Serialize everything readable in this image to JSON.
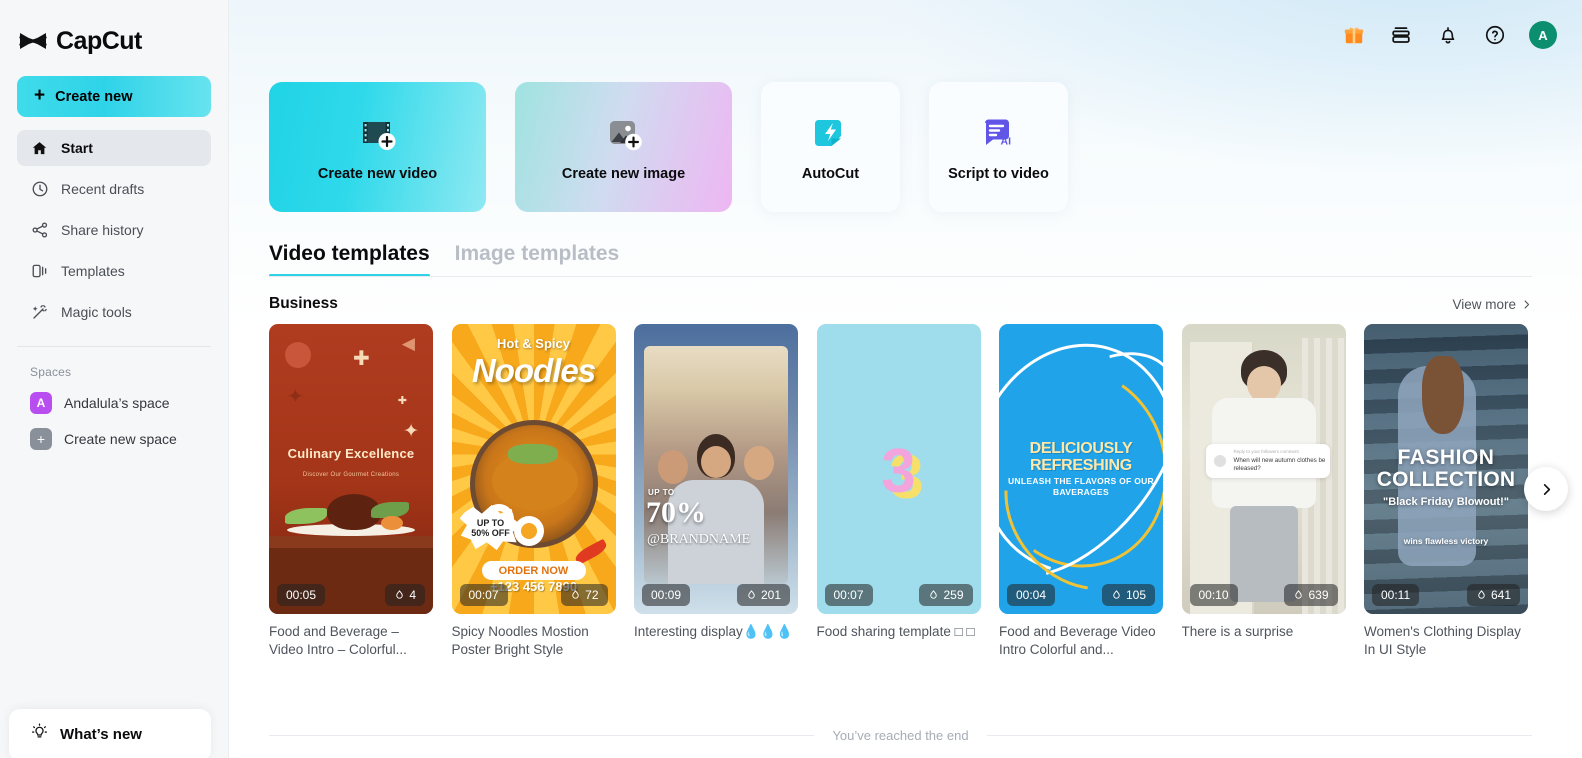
{
  "brand": {
    "name": "CapCut"
  },
  "sidebar": {
    "create_new_label": "Create new",
    "items": [
      {
        "label": "Start",
        "icon": "home-icon"
      },
      {
        "label": "Recent drafts",
        "icon": "clock-icon"
      },
      {
        "label": "Share history",
        "icon": "share-icon"
      },
      {
        "label": "Templates",
        "icon": "templates-icon"
      },
      {
        "label": "Magic tools",
        "icon": "magic-wand-icon"
      }
    ],
    "spaces_label": "Spaces",
    "spaces": [
      {
        "label": "Andalula’s space",
        "badge": "A",
        "badge_color": "#b84ef0"
      },
      {
        "label": "Create new space",
        "badge": "+",
        "badge_color": "#8a9099"
      }
    ],
    "whats_new_label": "What’s new"
  },
  "topbar": {
    "icons": [
      "gift-icon",
      "wallet-icon",
      "bell-icon",
      "help-icon"
    ],
    "avatar_initial": "A",
    "avatar_color": "#0b8f6e"
  },
  "actions": [
    {
      "label": "Create new video",
      "icon": "film-plus-icon"
    },
    {
      "label": "Create new image",
      "icon": "image-plus-icon"
    },
    {
      "label": "AutoCut",
      "icon": "autocut-icon"
    },
    {
      "label": "Script to video",
      "icon": "script-ai-icon"
    }
  ],
  "tabs": [
    {
      "label": "Video templates",
      "active": true
    },
    {
      "label": "Image templates",
      "active": false
    }
  ],
  "section": {
    "title": "Business",
    "view_more_label": "View more"
  },
  "templates": [
    {
      "caption": "Food and Beverage – Video Intro – Colorful...",
      "duration": "00:05",
      "likes": "4",
      "art": "t1",
      "art_text": {
        "title": "Culinary Excellence",
        "sub": "Discover Our Gourmet Creations"
      }
    },
    {
      "caption": "Spicy Noodles Mostion Poster Bright Style",
      "duration": "00:07",
      "likes": "72",
      "art": "t2",
      "art_text": {
        "hot": "Hot & Spicy",
        "noodles": "Noodles",
        "burst1": "UP TO",
        "burst2": "50% OFF",
        "order": "ORDER NOW",
        "phone": "+123 456 7890"
      }
    },
    {
      "caption": "Interesting display💧💧💧",
      "duration": "00:09",
      "likes": "201",
      "art": "t3",
      "art_text": {
        "upto": "UP TO",
        "pct": "70%",
        "brand": "@BRANDNAME"
      }
    },
    {
      "caption": "Food sharing template □ □",
      "duration": "00:07",
      "likes": "259",
      "art": "t4",
      "art_text": {
        "count": "3"
      }
    },
    {
      "caption": "Food and Beverage Video Intro Colorful and...",
      "duration": "00:04",
      "likes": "105",
      "art": "t5",
      "art_text": {
        "title": "DELICIOUSLY REFRESHING",
        "sub": "UNLEASH THE FLAVORS OF OUR BAVERAGES"
      }
    },
    {
      "caption": "There is a surprise",
      "duration": "00:10",
      "likes": "639",
      "art": "t6",
      "art_text": {
        "reply": "Reply to your followers comment",
        "msg": "When will new autumn clothes be released?"
      }
    },
    {
      "caption": "Women's Clothing Display In UI Style",
      "duration": "00:11",
      "likes": "641",
      "art": "t7",
      "art_text": {
        "l1": "FASHION",
        "l2": "COLLECTION",
        "l3": "\"Black Friday Blowout!\"",
        "l4": "wins  flawless victory"
      }
    }
  ],
  "footer": {
    "end_text": "You’ve reached the end"
  }
}
